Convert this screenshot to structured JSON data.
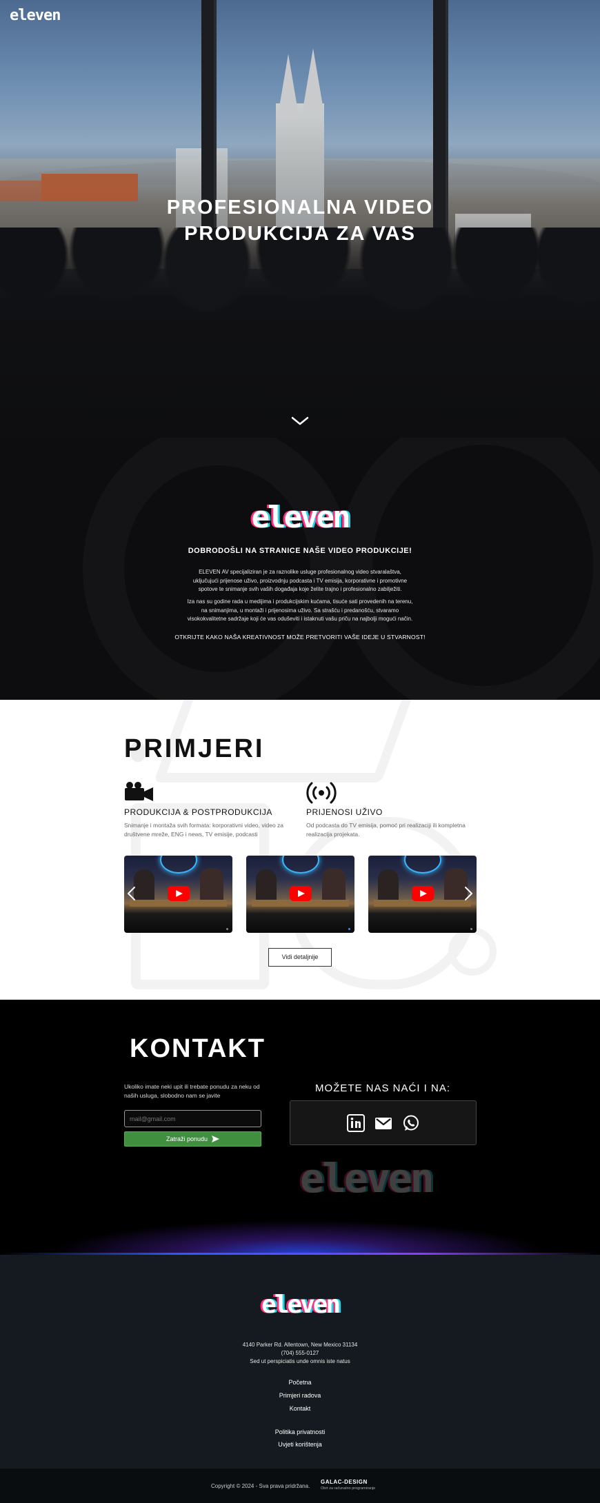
{
  "brand": {
    "logo": "eleven"
  },
  "hero": {
    "title_line1": "PROFESIONALNA VIDEO",
    "title_line2": "PRODUKCIJA ZA VAS",
    "scroll_icon": "chevron-down-icon"
  },
  "welcome": {
    "logo": "eleven",
    "title": "DOBRODOŠLI NA STRANICE NAŠE VIDEO PRODUKCIJE!",
    "p1_l1": "ELEVEN AV specijaliziran  je za raznolike usluge profesionalnog video stvaralaštva,",
    "p1_l2": "uključujući prijenose uživo, proizvodnju podcasta i TV emisija, korporativne i  promotivne",
    "p1_l3": "spotove te snimanje svih vaših događaja koje želite trajno i profesionalno zabilježiti.",
    "p2_l1": "Iza nas su godine rada u medijima i produkcijskim kućama, tisuće sati provedenih na terenu,",
    "p2_l2": "na snimanjima, u montaži i prijenosima uživo. Sa strašću i predanošću, stvaramo",
    "p2_l3": "visokokvalitetne sadržaje koji će vas oduševiti i istaknuti vašu priču na najbolji mogući način.",
    "cta": "OTKRIJTE KAKO NAŠA KREATIVNOST MOŽE PRETVORITI VAŠE IDEJE U STVARNOST!"
  },
  "examples": {
    "heading": "PRIMJERI",
    "services": [
      {
        "icon": "video-camera-icon",
        "title": "PRODUKCIJA & POSTPRODUKCIJA",
        "desc_l1": "Snimanje i montaža svih formata: korporativni video, video za",
        "desc_l2": "društvene mreže, ENG i news, TV emisije, podcasti"
      },
      {
        "icon": "broadcast-icon",
        "title": "PRIJENOSI UŽIVO",
        "desc_l1": "Od podcasta do TV emisija, pomoć pri realizaciji ili kompletna",
        "desc_l2": "realizacija projekata."
      }
    ],
    "videos": [
      {
        "icon": "youtube-play-icon"
      },
      {
        "icon": "youtube-play-icon"
      },
      {
        "icon": "youtube-play-icon"
      }
    ],
    "prev_icon": "chevron-left-icon",
    "next_icon": "chevron-right-icon",
    "details_label": "Vidi detaljnije"
  },
  "contact": {
    "heading": "KONTAKT",
    "text_l1": "Ukoliko imate neki upit ili trebate ponudu za neku od",
    "text_l2": "naših usluga, slobodno nam se javite",
    "email_placeholder": "mail@gmail.com",
    "submit_label": "Zatraži ponudu",
    "find_title": "MOŽETE NAS NAĆI I NA:",
    "social": [
      "linkedin-icon",
      "gmail-icon",
      "whatsapp-icon"
    ],
    "watermark": "eleven"
  },
  "footer": {
    "logo": "eleven",
    "address": "4140 Parker Rd. Allentown, New Mexico 31134",
    "phone": "(704) 555-0127",
    "tagline": "Sed ut perspiciatis unde omnis iste natus",
    "nav": [
      "Početna",
      "Primjeri radova",
      "Kontakt"
    ],
    "legal": [
      "Politika privatnosti",
      "Uvjeti korištenja"
    ],
    "copyright": "Copyright © 2024 - Sva prava pridržana.",
    "credit_title": "GALAC-DESIGN",
    "credit_sub": "Obrt za računalno programiranje"
  },
  "colors": {
    "accent_pink": "#ff2d7a",
    "accent_cyan": "#27d3e8",
    "submit_green": "#3f8f3f",
    "glow_blue": "#2a5bff"
  }
}
